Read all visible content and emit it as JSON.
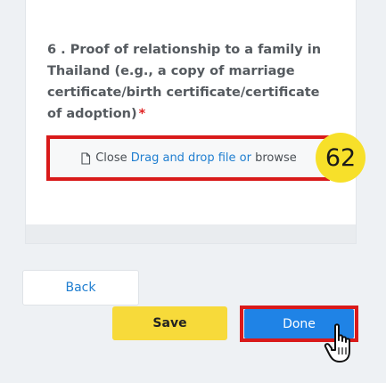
{
  "question": {
    "number_label": "6 . Proof of relationship to a family in Thailand (e.g., a copy of marriage certificate/birth certificate/certificate of adoption)",
    "required_mark": "*"
  },
  "upload": {
    "close_text": "Close",
    "drag_drop_text": "Drag and drop file",
    "or_text": "or",
    "browse_text": "browse",
    "icon": "file-icon"
  },
  "step_badge": {
    "label": "62",
    "color": "#f7e02a"
  },
  "buttons": {
    "back_label": "Back",
    "save_label": "Save",
    "done_label": "Done"
  },
  "colors": {
    "highlight_border": "#d91a1a",
    "link": "#1f7ed0",
    "done_bg": "#1f83e6",
    "save_bg": "#f7da3a"
  },
  "cursor": {
    "icon": "hand-pointer-icon"
  }
}
